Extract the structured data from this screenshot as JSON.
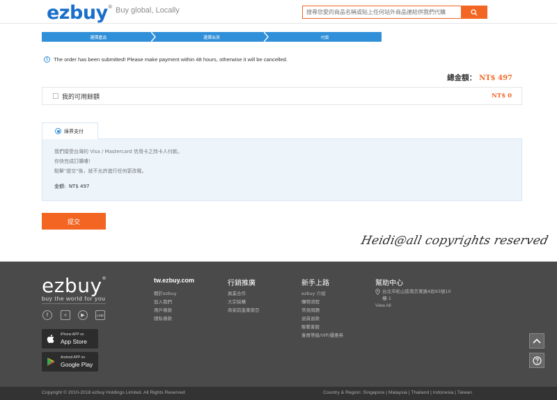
{
  "header": {
    "logo": "ezbuy",
    "logo_mark": "®",
    "tagline": "Buy global, Locally",
    "search_placeholder": "搜尋您愛的商品名稱或貼上任何站外商品連結供我們代購"
  },
  "steps": [
    "選擇產品",
    "選擇出貨",
    "付款"
  ],
  "notice": "The order has been submitted! Please make payment within 48 hours, otherwise it will be cancelled.",
  "total": {
    "label": "總金額：",
    "amount": "NT$ 497"
  },
  "balance": {
    "label": "我的可用餘額",
    "amount": "NT$ 0"
  },
  "payment": {
    "tab_label": "綠界支付",
    "lines": [
      "我們接受台灣的 Visa / Mastercard 信用卡之持卡人付款。",
      "你快完成訂購嘍！",
      "點擊\"提交\"後，就不允許進行任何更改喔。"
    ],
    "amount_label": "金額:",
    "amount": "NT$ 497"
  },
  "submit_label": "提交",
  "watermark": "Heidi@all copyrights reserved",
  "footer": {
    "logo": "ezbuy",
    "logo_mark": "®",
    "slogan": "buy the world for you",
    "social": [
      "f",
      "◎",
      "▶",
      "LINE"
    ],
    "stores": [
      {
        "small": "iPhone APP on",
        "big": "App Store"
      },
      {
        "small": "Android APP on",
        "big": "Google Play"
      }
    ],
    "columns": [
      {
        "title": "tw.ezbuy.com",
        "links": [
          "關於ezbuy",
          "加入我們",
          "用戶條款",
          "隱私條款"
        ]
      },
      {
        "title": "行銷推廣",
        "links": [
          "異業合作",
          "大宗採購",
          "商家前進東南亞"
        ]
      },
      {
        "title": "新手上路",
        "links": [
          "ezbuy 介紹",
          "購物流程",
          "常見問題",
          "退貨退款",
          "聯繫客服",
          "會員等級/VIP/優惠券"
        ]
      },
      {
        "title": "幫助中心",
        "address": "台北市松山區南京東路4段93號10樓-1",
        "view_all": "View All"
      }
    ],
    "copyright": "Copyright © 2010-2018 ezbuy Holdings Limited. All Rights Reserved",
    "countries": "Country & Region: Singapore | Malaysia | Thailand | Indonesia | Taiwan"
  },
  "colors": {
    "brand_blue": "#1a6fc9",
    "step_blue": "#2f8fd8",
    "accent_orange": "#f26522",
    "footer_bg": "#4a4a4a"
  },
  "icons": {
    "search": "search-icon",
    "info": "info-icon",
    "back_to_top": "chevron-up-icon",
    "help": "help-icon"
  }
}
